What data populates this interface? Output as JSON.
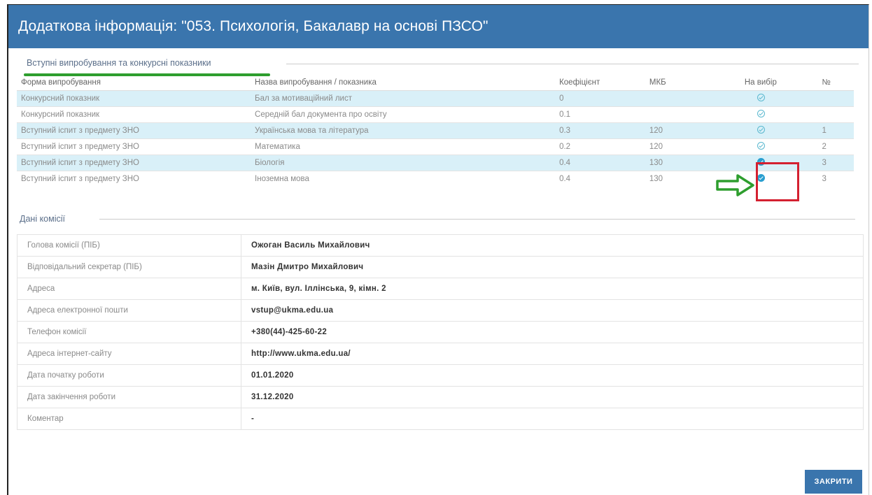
{
  "dialog": {
    "title": "Додаткова інформація: \"053. Психологія, Бакалавр на основі ПЗСО\""
  },
  "tests_section": {
    "label": "Вступні випробування та конкурсні показники",
    "columns": [
      "Форма випробування",
      "Назва випробування / показника",
      "Коефіцієнт",
      "МКБ",
      "На вибір",
      "№"
    ],
    "rows": [
      {
        "form": "Конкурсний показник",
        "name": "Бал за мотиваційний лист",
        "coef": "0",
        "mkb": "",
        "choice": "outline",
        "num": ""
      },
      {
        "form": "Конкурсний показник",
        "name": "Середній бал документа про освіту",
        "coef": "0.1",
        "mkb": "",
        "choice": "outline",
        "num": ""
      },
      {
        "form": "Вступний іспит з предмету ЗНО",
        "name": "Українська мова та література",
        "coef": "0.3",
        "mkb": "120",
        "choice": "outline",
        "num": "1"
      },
      {
        "form": "Вступний іспит з предмету ЗНО",
        "name": "Математика",
        "coef": "0.2",
        "mkb": "120",
        "choice": "outline",
        "num": "2"
      },
      {
        "form": "Вступний іспит з предмету ЗНО",
        "name": "Біологія",
        "coef": "0.4",
        "mkb": "130",
        "choice": "filled",
        "num": "3"
      },
      {
        "form": "Вступний іспит з предмету ЗНО",
        "name": "Іноземна мова",
        "coef": "0.4",
        "mkb": "130",
        "choice": "filled",
        "num": "3"
      }
    ]
  },
  "commission_section": {
    "label": "Дані комісії",
    "rows": [
      {
        "key": "Голова комісії (ПІБ)",
        "value": "Ожоган Василь Михайлович"
      },
      {
        "key": "Відповідальний секретар (ПІБ)",
        "value": "Мазін Дмитро Михайлович"
      },
      {
        "key": "Адреса",
        "value": "м. Київ, вул. Іллінська, 9, кімн. 2"
      },
      {
        "key": "Адреса електронної пошти",
        "value": "vstup@ukma.edu.ua"
      },
      {
        "key": "Телефон комісії",
        "value": "+380(44)-425-60-22"
      },
      {
        "key": "Адреса інтернет-сайту",
        "value": "http://www.ukma.edu.ua/"
      },
      {
        "key": "Дата початку роботи",
        "value": "01.01.2020"
      },
      {
        "key": "Дата закінчення роботи",
        "value": "31.12.2020"
      },
      {
        "key": "Коментар",
        "value": "-"
      }
    ]
  },
  "actions": {
    "close_label": "ЗАКРИТИ"
  },
  "colors": {
    "header": "#3a75ad",
    "highlight_row": "#d9f0f8",
    "annotation_box": "#d42030",
    "annotation_arrow": "#2e9e2e",
    "tab_underline": "#2e9e2e"
  }
}
